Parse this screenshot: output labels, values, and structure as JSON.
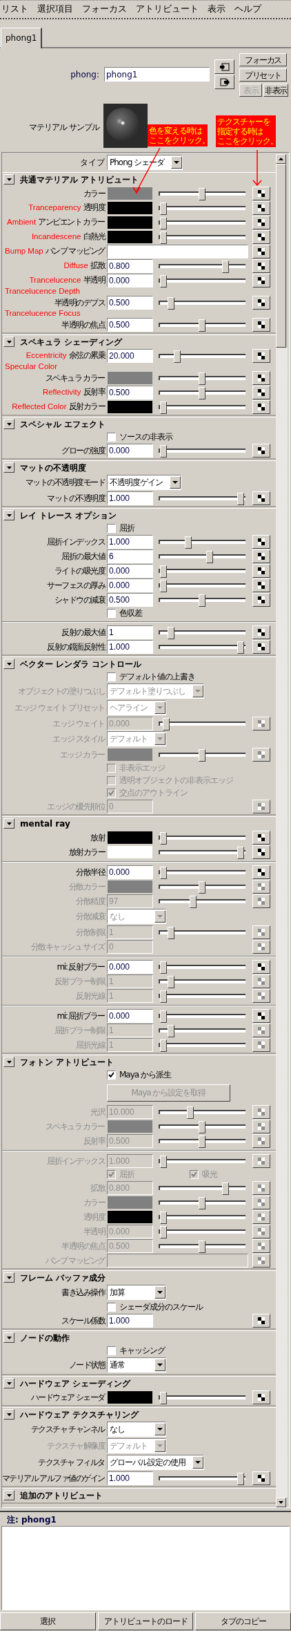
{
  "menu": [
    "リスト",
    "選択項目",
    "フォーカス",
    "アトリビュート",
    "表示",
    "ヘルプ"
  ],
  "tabs": [
    {
      "label": "phong1",
      "selected": true
    }
  ],
  "node": {
    "label": "phong:",
    "value": "phong1"
  },
  "side_buttons": [
    {
      "label": "フォーカス",
      "disabled": false
    },
    {
      "label": "プリセット",
      "disabled": false
    },
    {
      "label": "表示",
      "disabled": true
    },
    {
      "label": "非表示",
      "disabled": false
    }
  ],
  "sample_label": "マテリアル サンプル",
  "type_field": {
    "label": "タイプ",
    "value": "Phong シェーダ"
  },
  "callouts": [
    {
      "lines": [
        "色を変える時は",
        "ここをクリック。"
      ]
    },
    {
      "lines": [
        "テクスチャーを",
        "指定する時は",
        "ここをクリック。"
      ]
    }
  ],
  "sections": [
    {
      "title": "共通マテリアル アトリビュート",
      "expanded": true,
      "rows": [
        {
          "kind": "color",
          "label": "カラー",
          "color": "#808080",
          "level": 0.5,
          "disabled": false
        },
        {
          "kind": "color",
          "note": "Tranceparency",
          "label": "透明度",
          "color": "#000000",
          "level": 0,
          "disabled": false
        },
        {
          "kind": "color",
          "note": "Ambient",
          "label": "アンビエント カラー",
          "color": "#000000",
          "level": 0,
          "disabled": false
        },
        {
          "kind": "color",
          "note": "Incandescene",
          "label": "白熱光",
          "color": "#000000",
          "level": 0,
          "disabled": false
        },
        {
          "kind": "texture",
          "note": "Bump Map",
          "label": "バンプ マッピング",
          "disabled": false
        },
        {
          "kind": "number",
          "note": "Diffuse",
          "label": "拡散",
          "value": "0.800",
          "level": 0.8,
          "disabled": false
        },
        {
          "kind": "number",
          "note": "Trancelucence",
          "label": "半透明",
          "value": "0.000",
          "level": 0,
          "disabled": false
        },
        {
          "kind": "number",
          "note": "Trancelucence Depth",
          "note_above": true,
          "label": "半透明のデプス",
          "value": "0.500",
          "level": 0.1,
          "disabled": false
        },
        {
          "kind": "number",
          "note": "Trancelucence Focus",
          "note_above": true,
          "label": "半透明の焦点",
          "value": "0.500",
          "level": 0.5,
          "disabled": false
        }
      ]
    },
    {
      "title": "スペキュラ シェーディング",
      "expanded": true,
      "rows": [
        {
          "kind": "number",
          "note": "Eccentricity",
          "label": "余弦の累乗",
          "value": "20.000",
          "level": 0.18,
          "disabled": false
        },
        {
          "kind": "color",
          "note": "Specular Color",
          "note_above": true,
          "label": "スペキュラ カラー",
          "color": "#808080",
          "level": 0.5,
          "disabled": false
        },
        {
          "kind": "number",
          "note": "Reflectivity",
          "label": "反射率",
          "value": "0.500",
          "level": 0.5,
          "disabled": false
        },
        {
          "kind": "color",
          "note": "Reflected Color",
          "label": "反射カラー",
          "color": "#000000",
          "level": 0,
          "disabled": false
        }
      ]
    },
    {
      "title": "スペシャル エフェクト",
      "expanded": true,
      "rows": [
        {
          "kind": "checkbox",
          "label": "ソースの非表示",
          "checked": false,
          "disabled": false
        },
        {
          "kind": "number",
          "label": "グローの強度",
          "value": "0.000",
          "level": 0,
          "disabled": false
        }
      ]
    },
    {
      "title": "マットの不透明度",
      "expanded": true,
      "rows": [
        {
          "kind": "dropdown",
          "label": "マットの不透明度モード",
          "value": "不透明度ゲイン",
          "disabled": false
        },
        {
          "kind": "number",
          "label": "マットの不透明度",
          "value": "1.000",
          "level": 1,
          "disabled": false
        }
      ]
    },
    {
      "title": "レイ トレース オプション",
      "expanded": true,
      "rows": [
        {
          "kind": "checkbox",
          "label": "屈折",
          "checked": false,
          "disabled": false
        },
        {
          "kind": "number",
          "label": "屈折インデックス",
          "value": "1.000",
          "level": 0.32,
          "disabled": false
        },
        {
          "kind": "number",
          "label": "屈折の最大値",
          "value": "6",
          "level": 0.6,
          "disabled": false
        },
        {
          "kind": "number",
          "label": "ライトの吸光度",
          "value": "0.000",
          "level": 0,
          "disabled": false
        },
        {
          "kind": "number",
          "label": "サーフェスの厚み",
          "value": "0.000",
          "level": 0,
          "disabled": false
        },
        {
          "kind": "number",
          "label": "シャドウの減衰",
          "value": "0.500",
          "level": 0.5,
          "disabled": false
        },
        {
          "kind": "checkbox",
          "label": "色収差",
          "checked": false,
          "disabled": false
        },
        {
          "kind": "divider"
        },
        {
          "kind": "number",
          "label": "反射の最大値",
          "value": "1",
          "level": 0.1,
          "disabled": false
        },
        {
          "kind": "number",
          "label": "反射の鏡面反射性",
          "value": "1.000",
          "level": 1,
          "disabled": false
        }
      ]
    },
    {
      "title": "ベクター レンダラ コントロール",
      "expanded": true,
      "rows": [
        {
          "kind": "checkbox",
          "label": "デフォルト値の上書き",
          "checked": false,
          "disabled": false
        },
        {
          "kind": "dropdown",
          "label": "オブジェクトの塗りつぶし",
          "value": "デフォルト塗りつぶし",
          "disabled": true
        },
        {
          "kind": "dropdown",
          "label": "エッジ ウェイト プリセット",
          "value": "ヘアライン",
          "disabled": true
        },
        {
          "kind": "number",
          "label": "エッジ ウェイト",
          "value": "0.000",
          "level": 0.04,
          "disabled": true
        },
        {
          "kind": "dropdown",
          "label": "エッジ スタイル",
          "value": "デフォルト",
          "disabled": true
        },
        {
          "kind": "color",
          "label": "エッジ カラー",
          "color": "#808080",
          "level": 0.5,
          "disabled": true
        },
        {
          "kind": "checkbox",
          "label": "非表示エッジ",
          "checked": false,
          "disabled": true
        },
        {
          "kind": "checkbox",
          "label": "透明オブジェクトの非表示エッジ",
          "checked": false,
          "disabled": true
        },
        {
          "kind": "checkbox",
          "label": "交点のアウトライン",
          "checked": true,
          "disabled": true
        },
        {
          "kind": "number",
          "label": "エッジの優先順位",
          "value": "0",
          "disabled": true
        }
      ]
    },
    {
      "title": "mental ray",
      "expanded": true,
      "rows": [
        {
          "kind": "color",
          "label": "放射",
          "color": "#000000",
          "level": 0,
          "disabled": false
        },
        {
          "kind": "color",
          "label": "放射カラー",
          "color": "#ffffff",
          "level": 1,
          "disabled": false
        },
        {
          "kind": "divider"
        },
        {
          "kind": "number",
          "label": "分散半径",
          "value": "0.000",
          "level": 0,
          "disabled": false
        },
        {
          "kind": "color",
          "label": "分散カラー",
          "color": "#808080",
          "level": 0.5,
          "disabled": true
        },
        {
          "kind": "number",
          "label": "分散精度",
          "value": "97",
          "level": 0.38,
          "disabled": true
        },
        {
          "kind": "dropdown",
          "label": "分散減衰",
          "value": "なし",
          "disabled": true
        },
        {
          "kind": "number",
          "label": "分散制限",
          "value": "1",
          "level": 0.1,
          "disabled": true
        },
        {
          "kind": "number",
          "label": "分散キャッシュ サイズ",
          "value": "0",
          "disabled": true
        },
        {
          "kind": "divider"
        },
        {
          "kind": "number",
          "label": "mi: 反射ブラー",
          "value": "0.000",
          "level": 0,
          "disabled": false
        },
        {
          "kind": "number",
          "label": "反射ブラー制限",
          "value": "1",
          "level": 0.1,
          "disabled": true
        },
        {
          "kind": "number",
          "label": "反射光線",
          "value": "1",
          "level": 0,
          "disabled": true
        },
        {
          "kind": "divider"
        },
        {
          "kind": "number",
          "label": "mi: 屈折ブラー",
          "value": "0.000",
          "level": 0,
          "disabled": false
        },
        {
          "kind": "number",
          "label": "屈折ブラー制限",
          "value": "1",
          "level": 0.1,
          "disabled": true
        },
        {
          "kind": "number",
          "label": "屈折光線",
          "value": "1",
          "level": 0,
          "disabled": true
        }
      ]
    },
    {
      "title": "フォトン アトリビュート",
      "expanded": true,
      "rows": [
        {
          "kind": "checkbox",
          "label": "Maya から派生",
          "checked": true,
          "disabled": false
        },
        {
          "kind": "button",
          "label": "Maya から設定を取得",
          "disabled": true
        },
        {
          "kind": "number",
          "label": "光沢",
          "value": "10.000",
          "level": 0.35,
          "disabled": true
        },
        {
          "kind": "color",
          "label": "スペキュラ カラー",
          "color": "#808080",
          "level": 0.5,
          "disabled": true
        },
        {
          "kind": "number",
          "label": "反射率",
          "value": "0.500",
          "level": 0.5,
          "disabled": true
        },
        {
          "kind": "divider"
        },
        {
          "kind": "number",
          "label": "屈折インデックス",
          "value": "1.000",
          "level": 0,
          "disabled": true
        },
        {
          "kind": "checkbox_pair",
          "items": [
            {
              "label": "屈折",
              "checked": true,
              "disabled": true
            },
            {
              "label": "吸光",
              "checked": true,
              "disabled": true
            }
          ]
        },
        {
          "kind": "number",
          "label": "拡散",
          "value": "0.800",
          "level": 0.8,
          "disabled": true
        },
        {
          "kind": "color",
          "label": "カラー",
          "color": "#808080",
          "level": 0.5,
          "disabled": true
        },
        {
          "kind": "color",
          "label": "透明度",
          "color": "#000000",
          "level": 0,
          "disabled": true
        },
        {
          "kind": "number",
          "label": "半透明",
          "value": "0.000",
          "level": 0,
          "disabled": true
        },
        {
          "kind": "number",
          "label": "半透明の焦点",
          "value": "0.500",
          "level": 0.5,
          "disabled": true
        },
        {
          "kind": "texture",
          "label": "バンプ マッピング",
          "disabled": true
        }
      ]
    },
    {
      "title": "フレーム バッファ成分",
      "expanded": true,
      "rows": [
        {
          "kind": "dropdown",
          "label": "書き込み操作",
          "value": "加算",
          "disabled": false
        },
        {
          "kind": "checkbox",
          "label": "シェーダ成分のスケール",
          "checked": false,
          "disabled": false
        },
        {
          "kind": "number",
          "label": "スケール係数",
          "value": "1.000",
          "disabled": false
        }
      ]
    },
    {
      "title": "ノードの動作",
      "expanded": true,
      "rows": [
        {
          "kind": "checkbox",
          "label": "キャッシング",
          "checked": false,
          "disabled": false
        },
        {
          "kind": "dropdown",
          "label": "ノード状態",
          "value": "通常",
          "disabled": false
        }
      ]
    },
    {
      "title": "ハードウェア シェーディング",
      "expanded": true,
      "rows": [
        {
          "kind": "color",
          "label": "ハードウェア シェーダ",
          "color": "#000000",
          "level": 0,
          "disabled": false
        }
      ]
    },
    {
      "title": "ハードウェア テクスチャリング",
      "expanded": true,
      "rows": [
        {
          "kind": "dropdown",
          "label": "テクスチャ チャンネル",
          "value": "なし",
          "disabled": false
        },
        {
          "kind": "dropdown",
          "label": "テクスチャ解像度",
          "value": "デフォルト",
          "disabled": true
        },
        {
          "kind": "dropdown",
          "label": "テクスチャ フィルタ",
          "value": "グローバル設定の使用",
          "disabled": false
        },
        {
          "kind": "number",
          "label": "マテリアル アルファ値のゲイン",
          "value": "1.000",
          "level": 1,
          "disabled": false
        }
      ]
    },
    {
      "title": "追加のアトリビュート",
      "expanded": true
    }
  ],
  "notes": {
    "title": "注: phong1"
  },
  "bottom_buttons": [
    "選択",
    "アトリビュートのロード",
    "タブのコピー"
  ]
}
